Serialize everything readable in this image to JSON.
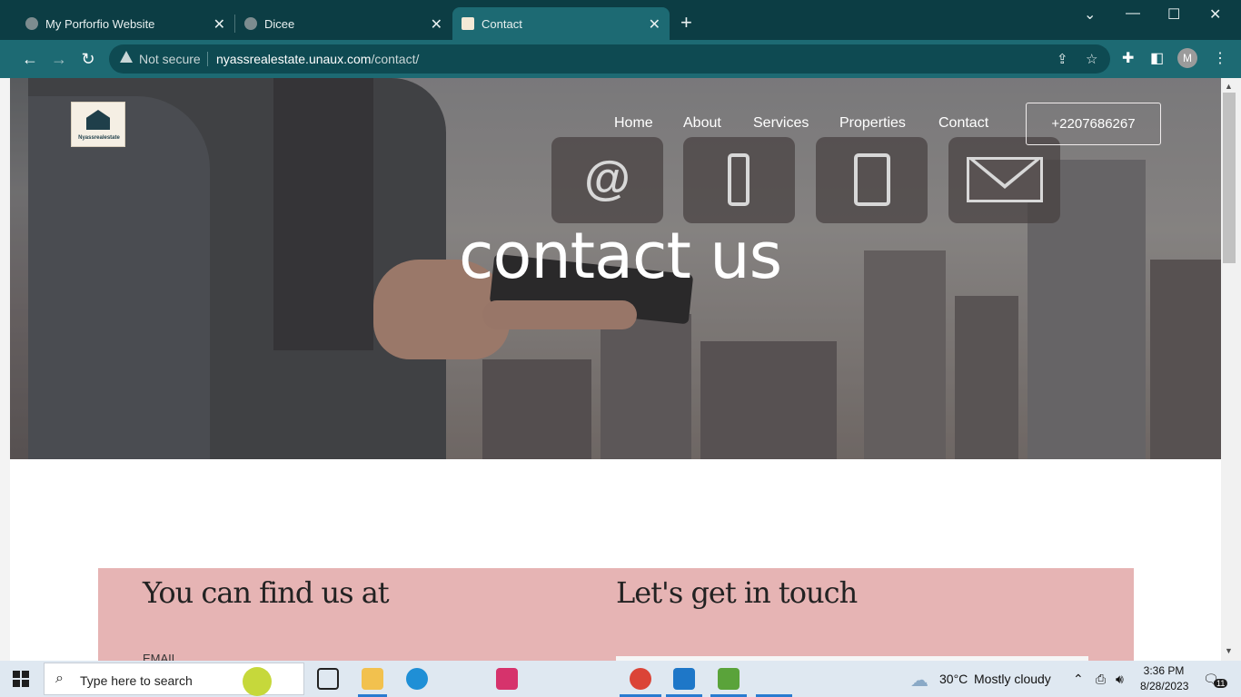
{
  "browser": {
    "tabs": [
      {
        "title": "My Porforfio Website",
        "close": "✕"
      },
      {
        "title": "Dicee",
        "close": "✕"
      },
      {
        "title": "Contact",
        "close": "✕"
      }
    ],
    "new_tab": "+",
    "security_label": "Not secure",
    "url_host": "nyassrealestate.unaux.com",
    "url_path": "/contact/",
    "profile_initial": "M"
  },
  "site": {
    "logo_text": "Nyassrealestate",
    "nav": [
      "Home",
      "About",
      "Services",
      "Properties",
      "Contact"
    ],
    "phone_button": "+2207686267",
    "hero_title": "contact us",
    "contact_tiles": [
      "@",
      "phone",
      "tablet",
      "mail"
    ],
    "find_us_heading": "You can find us at",
    "get_in_touch_heading": "Let's get in touch",
    "email_label": "EMAIL"
  },
  "taskbar": {
    "search_placeholder": "Type here to search",
    "weather_temp": "30°C",
    "weather_text": "Mostly cloudy",
    "time": "3:36 PM",
    "date": "8/28/2023",
    "notification_count": "11"
  },
  "colors": {
    "tabstrip": "#0c3d44",
    "toolbar": "#1d6a73",
    "pink_section": "#e6b4b4"
  }
}
